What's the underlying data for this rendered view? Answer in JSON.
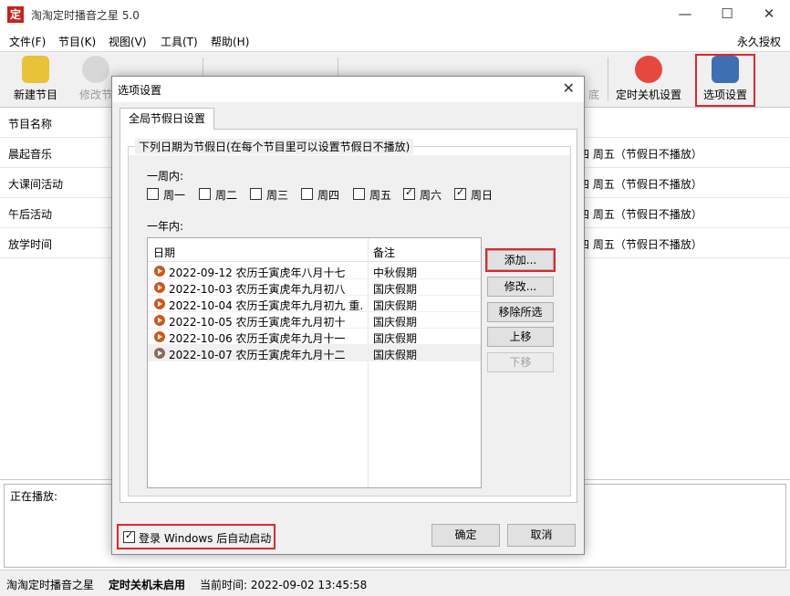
{
  "app": {
    "title": "淘淘定时播音之星 5.0",
    "icon_char": "定",
    "license": "永久授权"
  },
  "menu": [
    "文件(F)",
    "节目(K)",
    "视图(V)",
    "工具(T)",
    "帮助(H)"
  ],
  "toolbar": {
    "new_program": "新建节目",
    "edit_program": "修改节",
    "shutdown": "定时关机设置",
    "options": "选项设置",
    "partial_label": "底"
  },
  "program_list": {
    "header": "节目名称",
    "rows": [
      {
        "name": "晨起音乐",
        "schedule": "四 周五（节假日不播放）"
      },
      {
        "name": "大课间活动",
        "schedule": "四 周五（节假日不播放）"
      },
      {
        "name": "午后活动",
        "schedule": "四 周五（节假日不播放）"
      },
      {
        "name": "放学时间",
        "schedule": "四 周五（节假日不播放）"
      }
    ]
  },
  "now_playing_label": "正在播放:",
  "status": {
    "app_name": "淘淘定时播音之星",
    "shutdown_state": "定时关机未启用",
    "current_time": "当前时间:  2022-09-02 13:45:58"
  },
  "dialog": {
    "title": "选项设置",
    "tab": "全局节假日设置",
    "group_label": "下列日期为节假日(在每个节目里可以设置节假日不播放)",
    "week_label": "一周内:",
    "weekdays": [
      {
        "label": "周一",
        "checked": false
      },
      {
        "label": "周二",
        "checked": false
      },
      {
        "label": "周三",
        "checked": false
      },
      {
        "label": "周四",
        "checked": false
      },
      {
        "label": "周五",
        "checked": false
      },
      {
        "label": "周六",
        "checked": true
      },
      {
        "label": "周日",
        "checked": true
      }
    ],
    "year_label": "一年内:",
    "columns": {
      "date": "日期",
      "note": "备注"
    },
    "holidays": [
      {
        "date": "2022-09-12 农历壬寅虎年八月十七",
        "note": "中秋假期"
      },
      {
        "date": "2022-10-03 农历壬寅虎年九月初八",
        "note": "国庆假期"
      },
      {
        "date": "2022-10-04 农历壬寅虎年九月初九 重...",
        "note": "国庆假期"
      },
      {
        "date": "2022-10-05 农历壬寅虎年九月初十",
        "note": "国庆假期"
      },
      {
        "date": "2022-10-06 农历壬寅虎年九月十一",
        "note": "国庆假期"
      },
      {
        "date": "2022-10-07 农历壬寅虎年九月十二",
        "note": "国庆假期"
      }
    ],
    "buttons": {
      "add": "添加...",
      "edit": "修改...",
      "remove": "移除所选",
      "up": "上移",
      "down": "下移"
    },
    "autostart_label": "登录 Windows 后自动启动",
    "autostart_checked": true,
    "ok": "确定",
    "cancel": "取消"
  },
  "colors": {
    "highlight": "#e0262e",
    "arrow": "#e0262e"
  }
}
